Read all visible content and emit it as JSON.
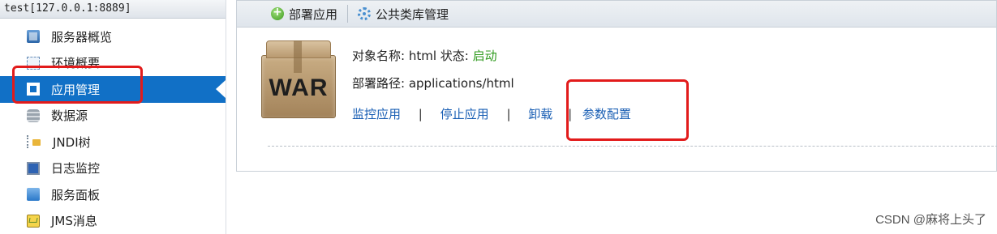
{
  "sidebar": {
    "server_title": "test[127.0.0.1:8889]",
    "items": [
      {
        "label": "服务器概览",
        "icon": "server-overview-icon",
        "active": false
      },
      {
        "label": "环境概要",
        "icon": "environment-icon",
        "active": false
      },
      {
        "label": "应用管理",
        "icon": "application-icon",
        "active": true
      },
      {
        "label": "数据源",
        "icon": "database-icon",
        "active": false
      },
      {
        "label": "JNDI树",
        "icon": "jndi-tree-icon",
        "active": false
      },
      {
        "label": "日志监控",
        "icon": "monitor-icon",
        "active": false
      },
      {
        "label": "服务面板",
        "icon": "service-panel-icon",
        "active": false
      },
      {
        "label": "JMS消息",
        "icon": "jms-message-icon",
        "active": false
      }
    ]
  },
  "toolbar": {
    "deploy_label": "部署应用",
    "library_label": "公共类库管理"
  },
  "app": {
    "icon_text": "WAR",
    "name_label": "对象名称:",
    "name_value": "html",
    "status_label": "状态:",
    "status_value": "启动",
    "path_label": "部署路径:",
    "path_value": "applications/html",
    "actions": {
      "monitor": "监控应用",
      "stop": "停止应用",
      "uninstall": "卸载",
      "params": "参数配置",
      "separator": "|"
    }
  },
  "watermark": "CSDN @麻将上头了",
  "colors": {
    "active_nav": "#1170c6",
    "link": "#1a5fb4",
    "status_ok": "#2e9a1c",
    "annotation": "#e21b1b"
  }
}
